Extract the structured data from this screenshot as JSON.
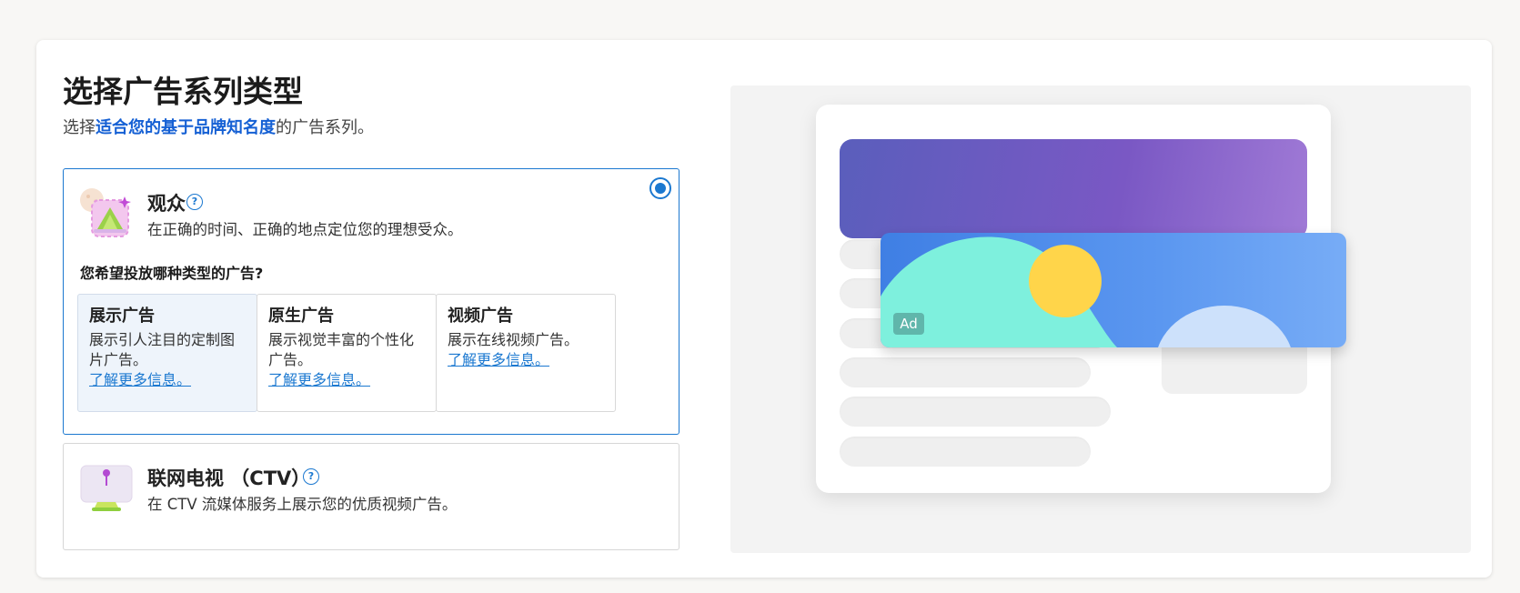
{
  "page": {
    "title": "选择广告系列类型",
    "subtitle_prefix": "选择",
    "subtitle_highlight": "适合您的基于品牌知名度",
    "subtitle_suffix": "的广告系列。"
  },
  "options": [
    {
      "name": "观众",
      "help": "?",
      "description": "在正确的时间、正确的地点定位您的理想受众。",
      "selected": true,
      "question": "您希望投放哪种类型的广告?",
      "sub_options": [
        {
          "title": "展示广告",
          "description": "展示引人注目的定制图片广告。",
          "link": "了解更多信息。",
          "active": true
        },
        {
          "title": "原生广告",
          "description": "展示视觉丰富的个性化广告。",
          "link": "了解更多信息。",
          "active": false
        },
        {
          "title": "视频广告",
          "description": "展示在线视频广告。",
          "link": "了解更多信息。",
          "active": false
        }
      ]
    },
    {
      "name": "联网电视 （CTV）",
      "help": "?",
      "description": "在 CTV 流媒体服务上展示您的优质视频广告。",
      "selected": false
    }
  ],
  "preview": {
    "ad_badge": "Ad"
  },
  "colors": {
    "accent": "#1b78d0",
    "highlight_text": "#1560d4",
    "active_sub_bg": "#eef4fb"
  }
}
